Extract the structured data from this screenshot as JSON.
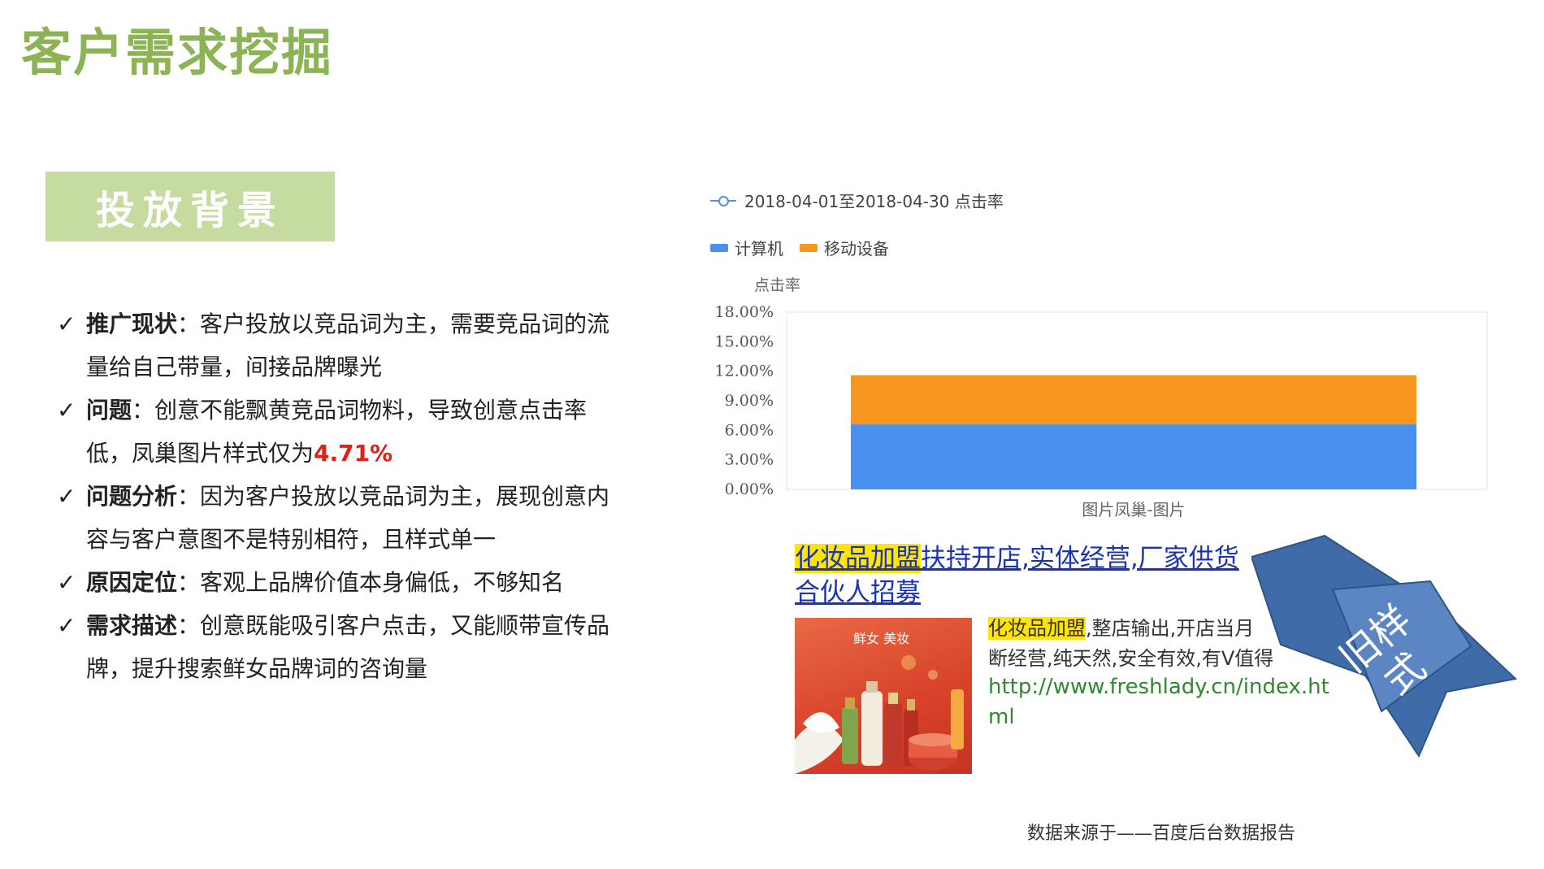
{
  "page_title": "客户需求挖掘",
  "section_badge": "投放背景",
  "bullets": [
    {
      "check": "✓",
      "label": "推广现状",
      "sep": "：",
      "text": "客户投放以竞品词为主，需要竞品词的流量给自己带量，间接品牌曝光"
    },
    {
      "check": "✓",
      "label": "问题",
      "sep": "：",
      "text": "创意不能飘黄竞品词物料，导致创意点击率低，凤巢图片样式仅为",
      "highlight": "4.71%"
    },
    {
      "check": "✓",
      "label": "问题分析",
      "sep": "：",
      "text": "因为客户投放以竞品词为主，展现创意内容与客户意图不是特别相符，且样式单一"
    },
    {
      "check": "✓",
      "label": "原因定位",
      "sep": "：",
      "text": "客观上品牌价值本身偏低，不够知名"
    },
    {
      "check": "✓",
      "label": "需求描述",
      "sep": "：",
      "text": "创意既能吸引客户点击，又能顺带宣传品牌，提升搜索鲜女品牌词的咨询量"
    }
  ],
  "chart_data": {
    "type": "bar",
    "stacked": true,
    "line_legend": "2018-04-01至2018-04-30 点击率",
    "ylabel": "点击率",
    "categories": [
      "图片凤巢-图片"
    ],
    "series": [
      {
        "name": "计算机",
        "values": [
          6.6
        ],
        "color": "#4a90ee"
      },
      {
        "name": "移动设备",
        "values": [
          5.0
        ],
        "color": "#f7971d"
      }
    ],
    "ylim": [
      0,
      18
    ],
    "yticks": [
      "0.00%",
      "3.00%",
      "6.00%",
      "9.00%",
      "12.00%",
      "15.00%",
      "18.00%"
    ],
    "ytick_values": [
      0,
      3,
      6,
      9,
      12,
      15,
      18
    ],
    "legend_placement": "top-left",
    "grid": false
  },
  "ad": {
    "headline_highlight": "化妆品加盟",
    "headline_rest": "扶持开店,实体经营,厂家供货",
    "headline_line2": "合伙人招募",
    "image_brand": "鲜女 美妆",
    "body_highlight": "化妆品加盟",
    "body_line1_rest": ",整店输出,开店当月",
    "body_line2": "断经营,纯天然,安全有效,有V值得",
    "url": "http://www.freshlady.cn/index.html"
  },
  "ribbon_label": "旧样式",
  "source_note": "数据来源于——百度后台数据报告"
}
